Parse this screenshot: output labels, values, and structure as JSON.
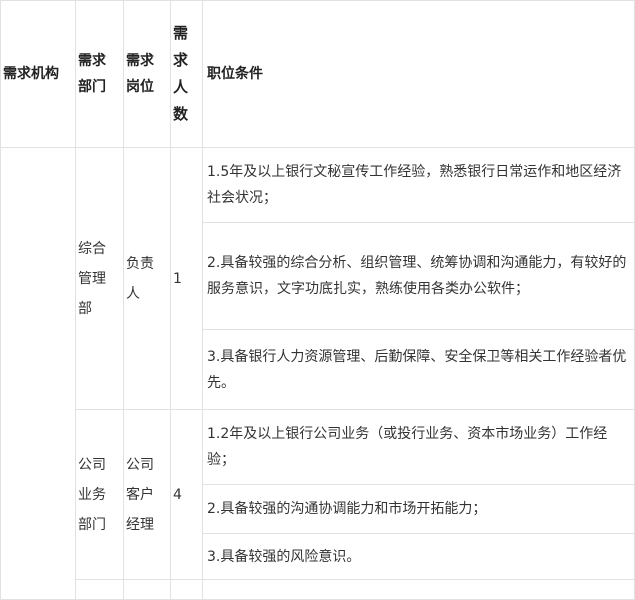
{
  "table": {
    "headers": {
      "org": "需求机构",
      "dept": "需求\n部门",
      "post": "需求\n岗位",
      "count": "需\n求\n人\n数",
      "cond": "职位条件"
    },
    "groups": [
      {
        "dept": "综合\n管理\n部",
        "post": "负责\n人",
        "count": "1",
        "conditions": [
          "1.5年及以上银行文秘宣传工作经验，熟悉银行日常运作和地区经济社会状况；",
          "2.具备较强的综合分析、组织管理、统筹协调和沟通能力，有较好的服务意识，文字功底扎实，熟练使用各类办公软件；",
          "3.具备银行人力资源管理、后勤保障、安全保卫等相关工作经验者优先。"
        ]
      },
      {
        "dept": "公司\n业务\n部门",
        "post": "公司\n客户\n经理",
        "count": "4",
        "conditions": [
          "1.2年及以上银行公司业务（或投行业务、资本市场业务）工作经验；",
          "2.具备较强的沟通协调能力和市场开拓能力；",
          "3.具备较强的风险意识。"
        ]
      }
    ]
  }
}
